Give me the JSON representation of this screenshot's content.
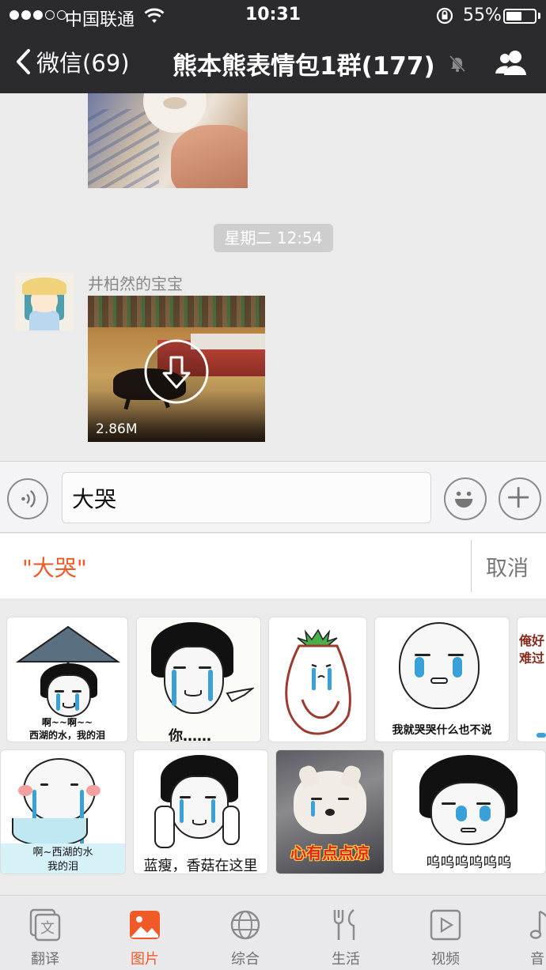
{
  "status_bar": {
    "carrier": "中国联通",
    "time": "10:31",
    "battery": "55%",
    "battery_level": 0.55,
    "signal_bars_filled": 3,
    "signal_bars_total": 5
  },
  "nav": {
    "back_label": "微信(69)",
    "title": "熊本熊表情包1群(177)",
    "icons": [
      "chevron-left-icon",
      "mute-bell-icon",
      "group-members-icon"
    ]
  },
  "chat": {
    "timestamp": "星期二 12:54",
    "message": {
      "sender": "井柏然的宝宝",
      "video_size": "2.86M"
    }
  },
  "input": {
    "value": "大哭",
    "icons": [
      "voice-icon",
      "emoji-icon",
      "plus-icon"
    ]
  },
  "search": {
    "query": "\"大哭\"",
    "cancel": "取消"
  },
  "stickers": {
    "row1": [
      {
        "caption_line1": "啊~~啊~~",
        "caption_line2": "西湖的水，我的泪"
      },
      {
        "caption": "你……"
      },
      {
        "caption": ""
      },
      {
        "caption": "我就哭哭什么也不说"
      },
      {
        "caption_line1": "俺好",
        "caption_line2": "难过"
      }
    ],
    "row2": [
      {
        "caption_line1": "啊~西湖的水",
        "caption_line2": "我的泪"
      },
      {
        "caption": "蓝瘦，香菇在这里"
      },
      {
        "caption": "心有点点凉"
      },
      {
        "caption": "呜呜呜呜呜呜"
      }
    ]
  },
  "tabs": [
    {
      "label": "翻译",
      "icon": "translate-icon",
      "active": false
    },
    {
      "label": "图片",
      "icon": "image-icon",
      "active": true
    },
    {
      "label": "综合",
      "icon": "globe-icon",
      "active": false
    },
    {
      "label": "生活",
      "icon": "cutlery-icon",
      "active": false
    },
    {
      "label": "视频",
      "icon": "video-play-icon",
      "active": false
    },
    {
      "label": "音",
      "icon": "music-note-icon",
      "active": false
    }
  ],
  "colors": {
    "accent": "#f05a28",
    "nav_bg": "#2b2b2e",
    "chat_bg": "#ebebeb",
    "tear": "#3aa0d8"
  }
}
